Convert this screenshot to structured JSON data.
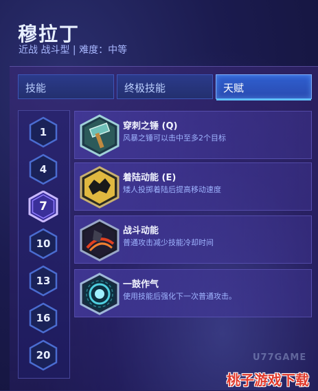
{
  "hero": {
    "name": "穆拉丁",
    "subtitle": "近战 战斗型 | 难度：中等"
  },
  "tabs": [
    {
      "label": "技能",
      "active": false
    },
    {
      "label": "终极技能",
      "active": false
    },
    {
      "label": "天赋",
      "active": true
    }
  ],
  "levels": [
    {
      "label": "1",
      "active": false
    },
    {
      "label": "4",
      "active": false
    },
    {
      "label": "7",
      "active": true
    },
    {
      "label": "10",
      "active": false
    },
    {
      "label": "13",
      "active": false
    },
    {
      "label": "16",
      "active": false
    },
    {
      "label": "20",
      "active": false
    }
  ],
  "talents": [
    {
      "name": "穿刺之锤 (Q)",
      "description": "风暴之锤可以击中至多2个目标",
      "icon": "hammer-icon"
    },
    {
      "name": "着陆动能 (E)",
      "description": "矮人投掷着陆后提高移动速度",
      "icon": "dwarf-leap-icon"
    },
    {
      "name": "战斗动能",
      "description": "普通攻击减少技能冷却时间",
      "icon": "combat-momentum-icon"
    },
    {
      "name": "一鼓作气",
      "description": "使用技能后强化下一次普通攻击。",
      "icon": "rune-orb-icon"
    }
  ],
  "watermark": {
    "site": "U77GAME",
    "brand": "桃子游戏下载"
  },
  "colors": {
    "accent": "#60c0ff",
    "active_tab": "#2f5fd0",
    "hex_active": "#8f7bff",
    "hex_normal": "#4a6cd0"
  }
}
